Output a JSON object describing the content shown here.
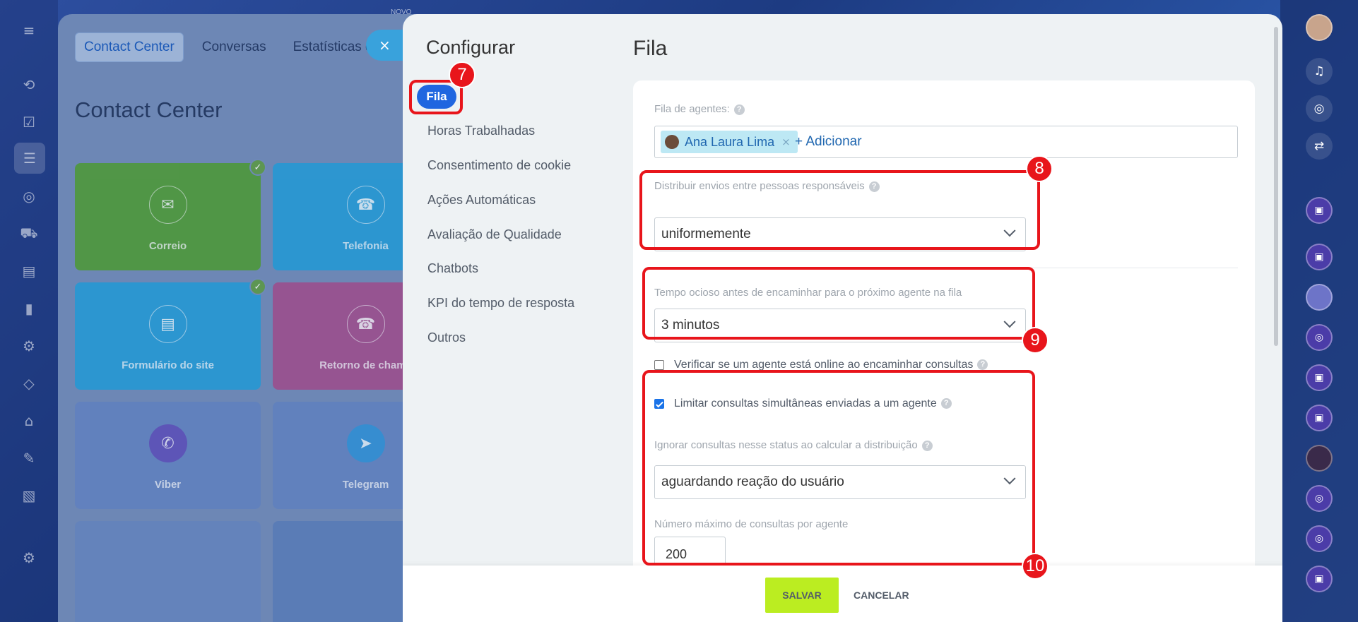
{
  "background": {
    "tabs": [
      "Contact Center",
      "Conversas",
      "Estatísticas de c"
    ],
    "title": "Contact Center",
    "novo": "NOVO",
    "tiles": [
      {
        "label": "Correio",
        "color": "#4a9a2e",
        "checked": true,
        "icon": "mail-icon"
      },
      {
        "label": "Telefonia",
        "color": "#1e9ad6",
        "checked": false,
        "icon": "phone-icon"
      },
      {
        "label": "Formulário do site",
        "color": "#1e9ad6",
        "checked": true,
        "icon": "form-icon"
      },
      {
        "label": "Retorno de chama",
        "color": "#a04a8a",
        "checked": false,
        "icon": "callback-icon"
      },
      {
        "label": "Viber",
        "color": "#5f80bf",
        "checked": false,
        "icon": "viber-icon"
      },
      {
        "label": "Telegram",
        "color": "#5f80bf",
        "checked": false,
        "icon": "telegram-icon"
      }
    ]
  },
  "slider": {
    "nav_title": "Configurar",
    "nav_items": [
      "Fila",
      "Horas Trabalhadas",
      "Consentimento de cookie",
      "Ações Automáticas",
      "Avaliação de Qualidade",
      "Chatbots",
      "KPI do tempo de resposta",
      "Outros"
    ],
    "main_title": "Fila",
    "queue_label": "Fila de agentes:",
    "agent_tag": "Ana Laura Lima",
    "add_link": "+ Adicionar",
    "distribute_label": "Distribuir envios entre pessoas responsáveis",
    "distribute_value": "uniformemente",
    "idle_label": "Tempo ocioso antes de encaminhar para o próximo agente na fila",
    "idle_value": "3 minutos",
    "check_online_label": "Verificar se um agente está online ao encaminhar consultas",
    "check_online_checked": false,
    "limit_label": "Limitar consultas simultâneas enviadas a um agente",
    "limit_checked": true,
    "ignore_label": "Ignorar consultas nesse status ao calcular a distribuição",
    "ignore_value": "aguardando reação do usuário",
    "max_label": "Número máximo de consultas por agente",
    "max_value": "200",
    "save": "SALVAR",
    "cancel": "CANCELAR",
    "help_glyph": "?"
  },
  "annotations": {
    "badge7": "7",
    "badge8": "8",
    "badge9": "9",
    "badge10": "10",
    "color": "#e8151b"
  },
  "close_glyph": "×"
}
